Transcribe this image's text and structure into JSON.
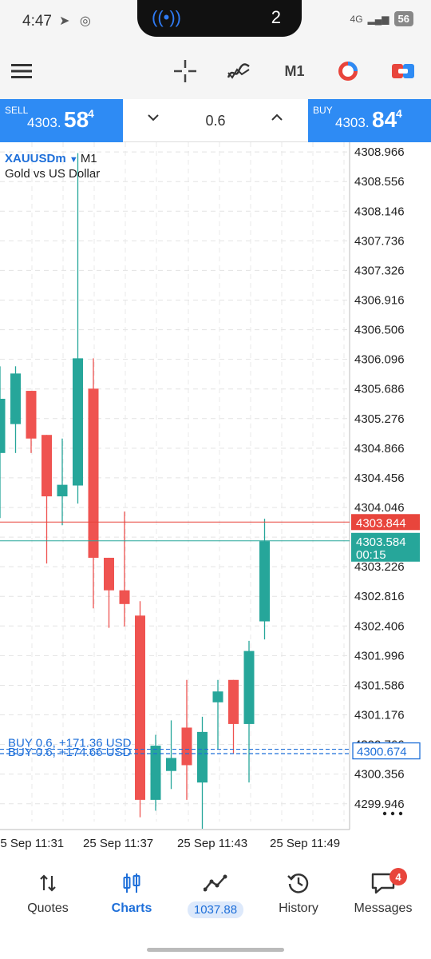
{
  "status": {
    "time": "4:47",
    "notif_count": "2",
    "network": "4G",
    "battery": "56"
  },
  "toolbar": {
    "timeframe": "M1"
  },
  "trade": {
    "sell_label": "SELL",
    "sell_main": "4303.",
    "sell_big": "58",
    "sell_sup": "4",
    "buy_label": "BUY",
    "buy_main": "4303.",
    "buy_big": "84",
    "buy_sup": "4",
    "volume": "0.6"
  },
  "chart": {
    "symbol": "XAUUSDm",
    "timeframe": "M1",
    "description": "Gold vs US Dollar"
  },
  "chart_data": {
    "type": "candlestick",
    "y_ticks": [
      "4308.966",
      "4308.556",
      "4308.146",
      "4307.736",
      "4307.326",
      "4306.916",
      "4306.506",
      "4306.096",
      "4305.686",
      "4305.276",
      "4304.866",
      "4304.456",
      "4304.046",
      "4303.636",
      "4303.226",
      "4302.816",
      "4302.406",
      "4301.996",
      "4301.586",
      "4301.176",
      "4300.766",
      "4300.356",
      "4299.946"
    ],
    "y_range": [
      4299.7,
      4309.1
    ],
    "x_labels": [
      "25 Sep 11:31",
      "25 Sep 11:37",
      "25 Sep 11:43",
      "25 Sep 11:49"
    ],
    "candles": [
      {
        "o": 4304.8,
        "h": 4306.0,
        "l": 4303.9,
        "c": 4305.55
      },
      {
        "o": 4305.2,
        "h": 4306.0,
        "l": 4304.8,
        "c": 4305.9
      },
      {
        "o": 4305.66,
        "h": 4305.66,
        "l": 4304.8,
        "c": 4305.0
      },
      {
        "o": 4305.05,
        "h": 4305.05,
        "l": 4303.27,
        "c": 4304.2
      },
      {
        "o": 4304.2,
        "h": 4305.0,
        "l": 4303.8,
        "c": 4304.36
      },
      {
        "o": 4304.35,
        "h": 4308.95,
        "l": 4304.1,
        "c": 4306.11
      },
      {
        "o": 4305.69,
        "h": 4306.11,
        "l": 4302.65,
        "c": 4303.35
      },
      {
        "o": 4303.35,
        "h": 4303.35,
        "l": 4302.38,
        "c": 4302.9
      },
      {
        "o": 4302.9,
        "h": 4303.99,
        "l": 4302.4,
        "c": 4302.71
      },
      {
        "o": 4302.55,
        "h": 4302.75,
        "l": 4299.76,
        "c": 4300.0
      },
      {
        "o": 4300.0,
        "h": 4300.9,
        "l": 4299.85,
        "c": 4300.75
      },
      {
        "o": 4300.4,
        "h": 4301.1,
        "l": 4300.15,
        "c": 4300.58
      },
      {
        "o": 4301.0,
        "h": 4301.66,
        "l": 4300.0,
        "c": 4300.48
      },
      {
        "o": 4300.24,
        "h": 4301.15,
        "l": 4299.6,
        "c": 4300.94
      },
      {
        "o": 4301.35,
        "h": 4301.66,
        "l": 4300.7,
        "c": 4301.5
      },
      {
        "o": 4301.66,
        "h": 4301.66,
        "l": 4300.64,
        "c": 4301.05
      },
      {
        "o": 4301.05,
        "h": 4302.2,
        "l": 4300.24,
        "c": 4302.06
      },
      {
        "o": 4302.47,
        "h": 4303.89,
        "l": 4302.22,
        "c": 4303.58
      }
    ],
    "ask_line": {
      "price": 4303.844,
      "label": "4303.844",
      "color": "#e8453c"
    },
    "bid_line": {
      "price": 4303.584,
      "label": "4303.584",
      "timer": "00:15",
      "color": "#26a69a"
    },
    "position_lines": [
      {
        "price": 4300.7,
        "label": "BUY 0.6,   +171.36 USD"
      },
      {
        "price": 4300.64,
        "label": "BUY 0.6,   +174.66 USD"
      }
    ],
    "position_price_label": "4300.674",
    "bull_color": "#26a69a",
    "bear_color": "#ef5350"
  },
  "nav": {
    "quotes": "Quotes",
    "charts": "Charts",
    "balance": "1037.88",
    "history": "History",
    "messages": "Messages",
    "messages_badge": "4"
  }
}
